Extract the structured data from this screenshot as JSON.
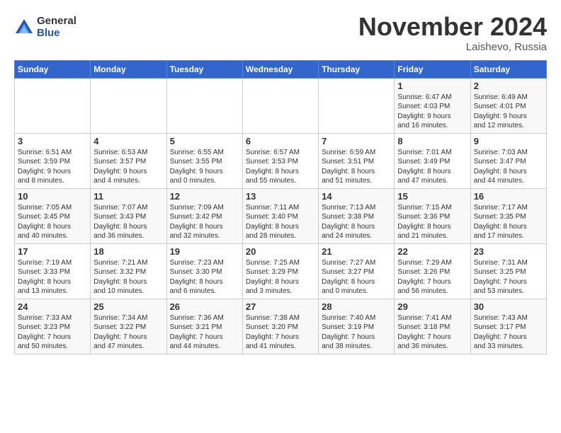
{
  "logo": {
    "general": "General",
    "blue": "Blue"
  },
  "title": "November 2024",
  "location": "Laishevo, Russia",
  "days_of_week": [
    "Sunday",
    "Monday",
    "Tuesday",
    "Wednesday",
    "Thursday",
    "Friday",
    "Saturday"
  ],
  "weeks": [
    [
      {
        "day": "",
        "info": ""
      },
      {
        "day": "",
        "info": ""
      },
      {
        "day": "",
        "info": ""
      },
      {
        "day": "",
        "info": ""
      },
      {
        "day": "",
        "info": ""
      },
      {
        "day": "1",
        "info": "Sunrise: 6:47 AM\nSunset: 4:03 PM\nDaylight: 9 hours\nand 16 minutes."
      },
      {
        "day": "2",
        "info": "Sunrise: 6:49 AM\nSunset: 4:01 PM\nDaylight: 9 hours\nand 12 minutes."
      }
    ],
    [
      {
        "day": "3",
        "info": "Sunrise: 6:51 AM\nSunset: 3:59 PM\nDaylight: 9 hours\nand 8 minutes."
      },
      {
        "day": "4",
        "info": "Sunrise: 6:53 AM\nSunset: 3:57 PM\nDaylight: 9 hours\nand 4 minutes."
      },
      {
        "day": "5",
        "info": "Sunrise: 6:55 AM\nSunset: 3:55 PM\nDaylight: 9 hours\nand 0 minutes."
      },
      {
        "day": "6",
        "info": "Sunrise: 6:57 AM\nSunset: 3:53 PM\nDaylight: 8 hours\nand 55 minutes."
      },
      {
        "day": "7",
        "info": "Sunrise: 6:59 AM\nSunset: 3:51 PM\nDaylight: 8 hours\nand 51 minutes."
      },
      {
        "day": "8",
        "info": "Sunrise: 7:01 AM\nSunset: 3:49 PM\nDaylight: 8 hours\nand 47 minutes."
      },
      {
        "day": "9",
        "info": "Sunrise: 7:03 AM\nSunset: 3:47 PM\nDaylight: 8 hours\nand 44 minutes."
      }
    ],
    [
      {
        "day": "10",
        "info": "Sunrise: 7:05 AM\nSunset: 3:45 PM\nDaylight: 8 hours\nand 40 minutes."
      },
      {
        "day": "11",
        "info": "Sunrise: 7:07 AM\nSunset: 3:43 PM\nDaylight: 8 hours\nand 36 minutes."
      },
      {
        "day": "12",
        "info": "Sunrise: 7:09 AM\nSunset: 3:42 PM\nDaylight: 8 hours\nand 32 minutes."
      },
      {
        "day": "13",
        "info": "Sunrise: 7:11 AM\nSunset: 3:40 PM\nDaylight: 8 hours\nand 28 minutes."
      },
      {
        "day": "14",
        "info": "Sunrise: 7:13 AM\nSunset: 3:38 PM\nDaylight: 8 hours\nand 24 minutes."
      },
      {
        "day": "15",
        "info": "Sunrise: 7:15 AM\nSunset: 3:36 PM\nDaylight: 8 hours\nand 21 minutes."
      },
      {
        "day": "16",
        "info": "Sunrise: 7:17 AM\nSunset: 3:35 PM\nDaylight: 8 hours\nand 17 minutes."
      }
    ],
    [
      {
        "day": "17",
        "info": "Sunrise: 7:19 AM\nSunset: 3:33 PM\nDaylight: 8 hours\nand 13 minutes."
      },
      {
        "day": "18",
        "info": "Sunrise: 7:21 AM\nSunset: 3:32 PM\nDaylight: 8 hours\nand 10 minutes."
      },
      {
        "day": "19",
        "info": "Sunrise: 7:23 AM\nSunset: 3:30 PM\nDaylight: 8 hours\nand 6 minutes."
      },
      {
        "day": "20",
        "info": "Sunrise: 7:25 AM\nSunset: 3:29 PM\nDaylight: 8 hours\nand 3 minutes."
      },
      {
        "day": "21",
        "info": "Sunrise: 7:27 AM\nSunset: 3:27 PM\nDaylight: 8 hours\nand 0 minutes."
      },
      {
        "day": "22",
        "info": "Sunrise: 7:29 AM\nSunset: 3:26 PM\nDaylight: 7 hours\nand 56 minutes."
      },
      {
        "day": "23",
        "info": "Sunrise: 7:31 AM\nSunset: 3:25 PM\nDaylight: 7 hours\nand 53 minutes."
      }
    ],
    [
      {
        "day": "24",
        "info": "Sunrise: 7:33 AM\nSunset: 3:23 PM\nDaylight: 7 hours\nand 50 minutes."
      },
      {
        "day": "25",
        "info": "Sunrise: 7:34 AM\nSunset: 3:22 PM\nDaylight: 7 hours\nand 47 minutes."
      },
      {
        "day": "26",
        "info": "Sunrise: 7:36 AM\nSunset: 3:21 PM\nDaylight: 7 hours\nand 44 minutes."
      },
      {
        "day": "27",
        "info": "Sunrise: 7:38 AM\nSunset: 3:20 PM\nDaylight: 7 hours\nand 41 minutes."
      },
      {
        "day": "28",
        "info": "Sunrise: 7:40 AM\nSunset: 3:19 PM\nDaylight: 7 hours\nand 38 minutes."
      },
      {
        "day": "29",
        "info": "Sunrise: 7:41 AM\nSunset: 3:18 PM\nDaylight: 7 hours\nand 36 minutes."
      },
      {
        "day": "30",
        "info": "Sunrise: 7:43 AM\nSunset: 3:17 PM\nDaylight: 7 hours\nand 33 minutes."
      }
    ]
  ]
}
